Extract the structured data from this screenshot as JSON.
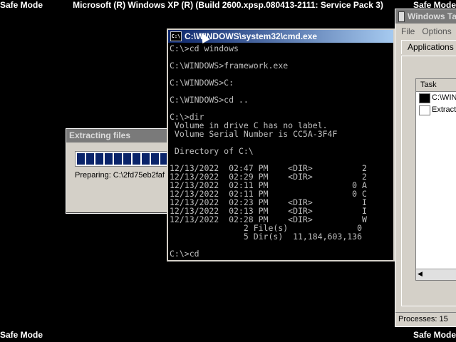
{
  "corners": {
    "safe_mode": "Safe Mode"
  },
  "banner": "Microsoft (R) Windows XP (R) (Build 2600.xpsp.080413-2111: Service Pack 3)",
  "extract_dialog": {
    "title": "Extracting files",
    "progress": 0.55,
    "status": "Preparing: C:\\2fd75eb2faf"
  },
  "cmd": {
    "title": "C:\\WINDOWS\\system32\\cmd.exe",
    "lines": [
      "C:\\>cd windows",
      "",
      "C:\\WINDOWS>framework.exe",
      "",
      "C:\\WINDOWS>C:",
      "",
      "C:\\WINDOWS>cd ..",
      "",
      "C:\\>dir",
      " Volume in drive C has no label.",
      " Volume Serial Number is CC5A-3F4F",
      "",
      " Directory of C:\\",
      "",
      "12/13/2022  02:47 PM    <DIR>          2",
      "12/13/2022  02:29 PM    <DIR>          2",
      "12/13/2022  02:11 PM                 0 A",
      "12/13/2022  02:11 PM                 0 C",
      "12/13/2022  02:23 PM    <DIR>          I",
      "12/13/2022  02:13 PM    <DIR>          I",
      "12/13/2022  02:28 PM    <DIR>          W",
      "               2 File(s)              0",
      "               5 Dir(s)  11,184,603,136",
      "",
      "C:\\>cd"
    ]
  },
  "task_manager": {
    "title": "Windows Ta",
    "menu": [
      "File",
      "Options"
    ],
    "tab": "Applications",
    "column": "Task",
    "rows": [
      "C:\\WIN",
      "Extract"
    ],
    "status": "Processes: 15"
  }
}
